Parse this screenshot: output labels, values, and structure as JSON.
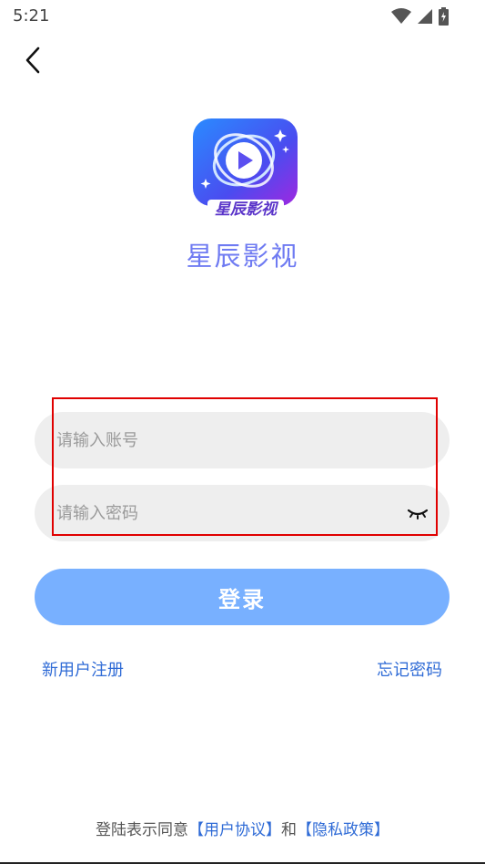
{
  "status_bar": {
    "time": "5:21",
    "icons": [
      "wifi-icon",
      "signal-icon",
      "battery-icon"
    ]
  },
  "header": {
    "back_icon": "chevron-left-icon"
  },
  "app": {
    "logo_text": "星辰影视",
    "name": "星辰影视"
  },
  "form": {
    "account_placeholder": "请输入账号",
    "account_value": "",
    "password_placeholder": "请输入密码",
    "password_value": "",
    "password_toggle_icon": "eye-closed-icon"
  },
  "actions": {
    "login_label": "登录",
    "register_label": "新用户注册",
    "forgot_label": "忘记密码"
  },
  "agreement": {
    "prefix": "登陆表示同意",
    "user_agreement": "【用户协议】",
    "conjunction": "和",
    "privacy_policy": "【隐私政策】"
  },
  "colors": {
    "accent": "#78b0ff",
    "link": "#2f6bd6",
    "app_name": "#6f7bf2",
    "highlight": "#e00000"
  }
}
